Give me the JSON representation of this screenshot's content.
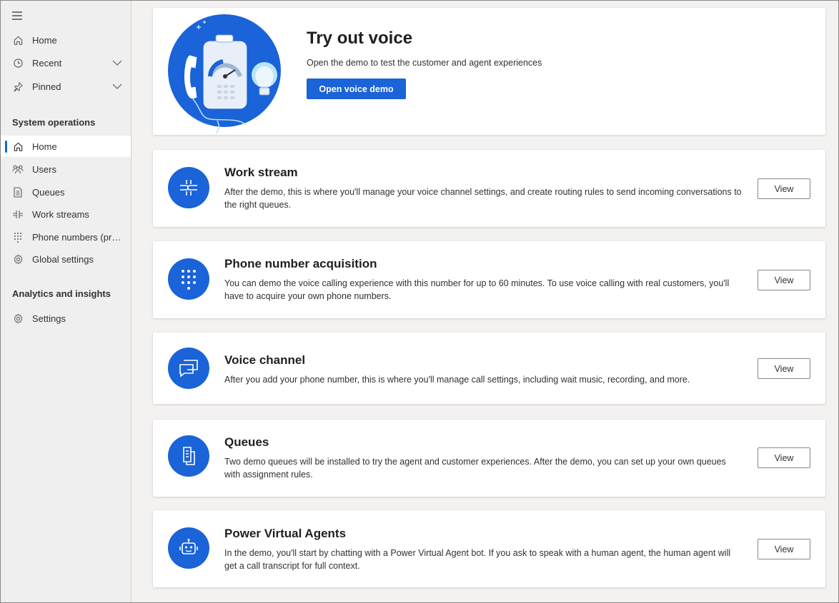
{
  "sidebar": {
    "menu_icon": "hamburger-icon",
    "top_items": [
      {
        "label": "Home",
        "icon": "home-icon"
      },
      {
        "label": "Recent",
        "icon": "clock-icon"
      },
      {
        "label": "Pinned",
        "icon": "pin-icon"
      }
    ],
    "section1_title": "System operations",
    "section1_items": [
      {
        "label": "Home",
        "icon": "home-icon",
        "active": true
      },
      {
        "label": "Users",
        "icon": "users-icon"
      },
      {
        "label": "Queues",
        "icon": "queues-icon"
      },
      {
        "label": "Work streams",
        "icon": "workstream-icon"
      },
      {
        "label": "Phone numbers (preview)",
        "icon": "dialpad-icon"
      },
      {
        "label": "Global settings",
        "icon": "gear-icon"
      }
    ],
    "section2_title": "Analytics and insights",
    "section2_items": [
      {
        "label": "Settings",
        "icon": "gear-icon"
      }
    ]
  },
  "hero": {
    "title": "Try out voice",
    "subtitle": "Open the demo to test the customer and agent experiences",
    "button_label": "Open voice demo"
  },
  "cards": [
    {
      "title": "Work stream",
      "description": "After the demo, this is where you'll manage your voice channel settings, and create routing rules to send incoming conversations to the right queues.",
      "button_label": "View",
      "icon": "workstream-icon"
    },
    {
      "title": "Phone number acquisition",
      "description": "You can demo the voice calling experience with this number for up to 60 minutes. To use voice calling with real customers, you'll have to acquire your own phone numbers.",
      "button_label": "View",
      "icon": "dialpad-icon"
    },
    {
      "title": "Voice channel",
      "description": "After you add your phone number, this is where you'll manage call settings, including wait music, recording, and more.",
      "button_label": "View",
      "icon": "chat-icon"
    },
    {
      "title": "Queues",
      "description": "Two demo queues will be installed to try the agent and customer experiences. After the demo, you can set up your own queues with assignment rules.",
      "button_label": "View",
      "icon": "queues-icon"
    },
    {
      "title": "Power Virtual Agents",
      "description": "In the demo, you'll start by chatting with a Power Virtual Agent bot. If you ask to speak with a human agent, the human agent will get a call transcript for full context.",
      "button_label": "View",
      "icon": "bot-icon"
    }
  ],
  "colors": {
    "accent": "#1a63d8",
    "active_indicator": "#0f6cbd",
    "sidebar_bg": "#efefef",
    "page_bg": "#f3f2f1"
  }
}
